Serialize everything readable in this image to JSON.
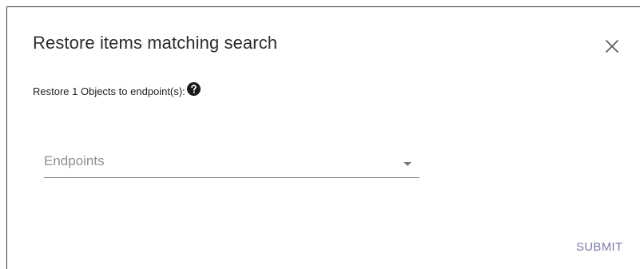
{
  "dialog": {
    "title": "Restore items matching search",
    "subtitle": "Restore 1 Objects to endpoint(s):",
    "endpoints_select": {
      "placeholder": "Endpoints"
    },
    "submit_label": "SUBMIT"
  },
  "icons": {
    "close": "close-icon",
    "help": "help-icon",
    "dropdown": "chevron-down-icon"
  },
  "colors": {
    "title": "#2d2d2d",
    "placeholder": "#8f8f8f",
    "submit": "#7b7bb0",
    "underline": "#8a8a8a"
  }
}
